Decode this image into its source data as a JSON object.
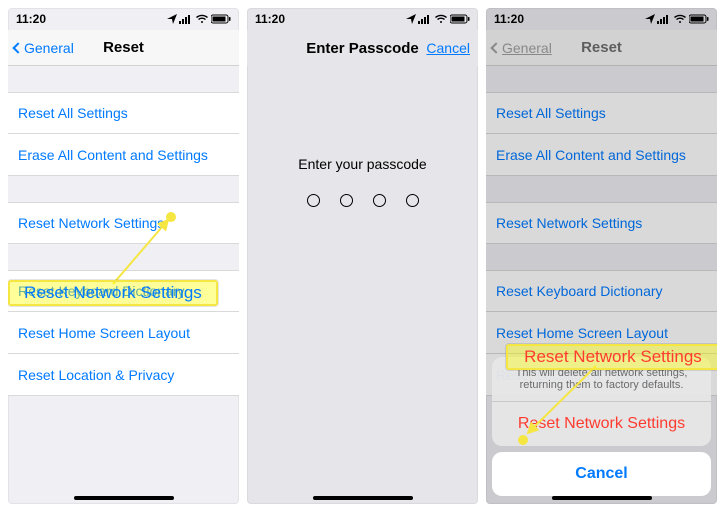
{
  "status": {
    "time": "11:20",
    "location_icon": "location",
    "signal_icon": "signal",
    "wifi_icon": "wifi",
    "battery_icon": "battery"
  },
  "panel1": {
    "nav": {
      "back": "General",
      "title": "Reset"
    },
    "rows": {
      "reset_all": "Reset All Settings",
      "erase_all": "Erase All Content and Settings",
      "reset_network": "Reset Network Settings",
      "reset_keyboard": "Reset Keyboard Dictionary",
      "reset_home": "Reset Home Screen Layout",
      "reset_location": "Reset Location & Privacy"
    },
    "highlight_label": "Reset Network Settings"
  },
  "panel2": {
    "nav": {
      "title": "Enter Passcode",
      "right": "Cancel"
    },
    "prompt": "Enter your passcode"
  },
  "panel3": {
    "nav": {
      "back": "General",
      "title": "Reset"
    },
    "rows": {
      "reset_all": "Reset All Settings",
      "erase_all": "Erase All Content and Settings",
      "reset_network": "Reset Network Settings",
      "reset_keyboard": "Reset Keyboard Dictionary",
      "reset_home": "Reset Home Screen Layout",
      "reset_location": "Reset Location & Privacy"
    },
    "sheet": {
      "message": "This will delete all network settings, returning them to factory defaults.",
      "confirm": "Reset Network Settings",
      "cancel": "Cancel"
    },
    "highlight_label": "Reset Network Settings"
  }
}
